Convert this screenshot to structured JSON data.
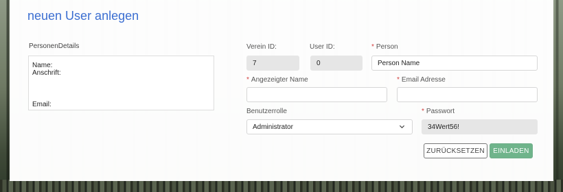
{
  "page": {
    "title": "neuen User anlegen"
  },
  "details": {
    "section_label": "PersonenDetails",
    "name_label": "Name:",
    "address_label": "Anschrift:",
    "email_label": "Email:"
  },
  "form": {
    "verein_id": {
      "label": "Verein ID:",
      "value": "7"
    },
    "user_id": {
      "label": "User ID:",
      "value": "0"
    },
    "person": {
      "label": "Person",
      "value": "Person Name",
      "required": true
    },
    "display_name": {
      "label": "Angezeigter Name",
      "value": "",
      "required": true
    },
    "email": {
      "label": "Email Adresse",
      "value": "",
      "required": true
    },
    "role": {
      "label": "Benutzerrolle",
      "selected": "Administrator"
    },
    "password": {
      "label": "Passwort",
      "value": "34Wert56!",
      "required": true
    }
  },
  "buttons": {
    "reset": "ZURÜCKSETZEN",
    "invite": "EINLADEN"
  },
  "colors": {
    "title": "#3b6ed1",
    "required_marker": "#d23b3b",
    "invite_button": "#6fb48b"
  },
  "icons": {
    "role_select_chevron": "chevron-down-icon"
  }
}
